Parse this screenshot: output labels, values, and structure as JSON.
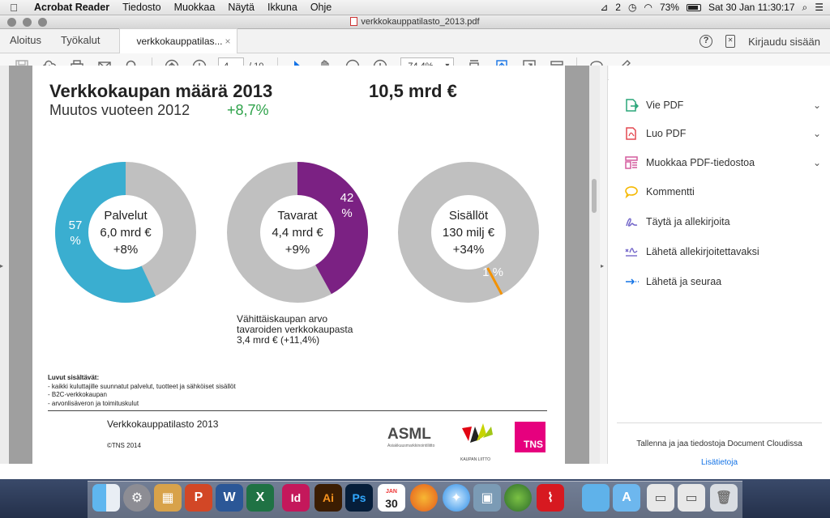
{
  "menubar": {
    "app": "Acrobat Reader",
    "items": [
      "Tiedosto",
      "Muokkaa",
      "Näytä",
      "Ikkuna",
      "Ohje"
    ],
    "status": {
      "notif_count": "2",
      "battery": "73%",
      "clock": "Sat 30 Jan  11:30:17"
    }
  },
  "window": {
    "title": "verkkokauppatilasto_2013.pdf"
  },
  "tabs": {
    "home": "Aloitus",
    "tools": "Työkalut",
    "document": "verkkokauppatilas...",
    "close": "×",
    "signin": "Kirjaudu sisään"
  },
  "toolbar": {
    "page_current": "4",
    "page_total": "/ 10",
    "zoom": "74,4%"
  },
  "page": {
    "title": "Verkkokaupan määrä 2013",
    "total": "10,5 mrd €",
    "subtitle": "Muutos vuoteen 2012",
    "change": "+8,7%",
    "note": "Vähittäiskaupan arvo\ntavaroiden verkkokaupasta\n3,4 mrd €  (+11,4%)",
    "includes_title": "Luvut sisältävät:",
    "includes": [
      "-    kaikki kuluttajille suunnatut palvelut, tuotteet ja sähköiset sisällöt",
      "-    B2C-verkkokaupan",
      "-    arvonlisäveron ja toimituskulut"
    ],
    "footer": "Verkkokauppatilasto 2013",
    "copyright": "©TNS 2014",
    "logo_asml": "ASML",
    "logo_asml_sub": "Asiakkuusmarkkinointiliitto",
    "logo_kl": "KAUPAN LIITTO",
    "logo_tns": "TNS"
  },
  "chart_data": [
    {
      "type": "pie",
      "center_title": "Palvelut",
      "center_value": "6,0 mrd €",
      "center_change": "+8%",
      "slice_label": "57\n%",
      "share_percent": 57,
      "colors": {
        "slice": "#3aaed0",
        "rest": "#c0c0c0"
      }
    },
    {
      "type": "pie",
      "center_title": "Tavarat",
      "center_value": "4,4 mrd €",
      "center_change": "+9%",
      "slice_label": "42\n%",
      "share_percent": 42,
      "colors": {
        "slice": "#7b2183",
        "rest": "#c0c0c0"
      }
    },
    {
      "type": "pie",
      "center_title": "Sisällöt",
      "center_value": "130 milj €",
      "center_change": "+34%",
      "slice_label": "1 %",
      "share_percent": 1,
      "colors": {
        "slice": "#f39200",
        "rest": "#c0c0c0"
      }
    }
  ],
  "right_panel": {
    "items": [
      {
        "label": "Vie PDF",
        "icon": "export-pdf-icon",
        "color": "#2aa579",
        "chevron": true
      },
      {
        "label": "Luo PDF",
        "icon": "create-pdf-icon",
        "color": "#e34850",
        "chevron": true
      },
      {
        "label": "Muokkaa PDF-tiedostoa",
        "icon": "edit-pdf-icon",
        "color": "#d45b9d",
        "chevron": true
      },
      {
        "label": "Kommentti",
        "icon": "comment-icon",
        "color": "#f5b800",
        "chevron": false
      },
      {
        "label": "Täytä ja allekirjoita",
        "icon": "fill-sign-icon",
        "color": "#7467ca",
        "chevron": false
      },
      {
        "label": "Lähetä allekirjoitettavaksi",
        "icon": "send-signature-icon",
        "color": "#7467ca",
        "chevron": false
      },
      {
        "label": "Lähetä ja seuraa",
        "icon": "send-track-icon",
        "color": "#1473e6",
        "chevron": false
      }
    ],
    "footer_text": "Tallenna ja jaa tiedostoja Document Cloudissa",
    "footer_link": "Lisätietoja"
  },
  "dock": {
    "calendar_month": "JAN",
    "calendar_day": "30",
    "apps": [
      "finder-icon",
      "system-preferences-icon",
      "calculator-icon",
      "powerpoint-icon",
      "word-icon",
      "excel-icon",
      "indesign-icon",
      "illustrator-icon",
      "photoshop-icon",
      "calendar-icon",
      "firefox-icon",
      "safari-icon",
      "preview-icon",
      "spotify-icon",
      "acrobat-icon",
      "folder-icon",
      "applications-icon",
      "downloads-icon",
      "screen-icon",
      "trash-icon"
    ]
  }
}
